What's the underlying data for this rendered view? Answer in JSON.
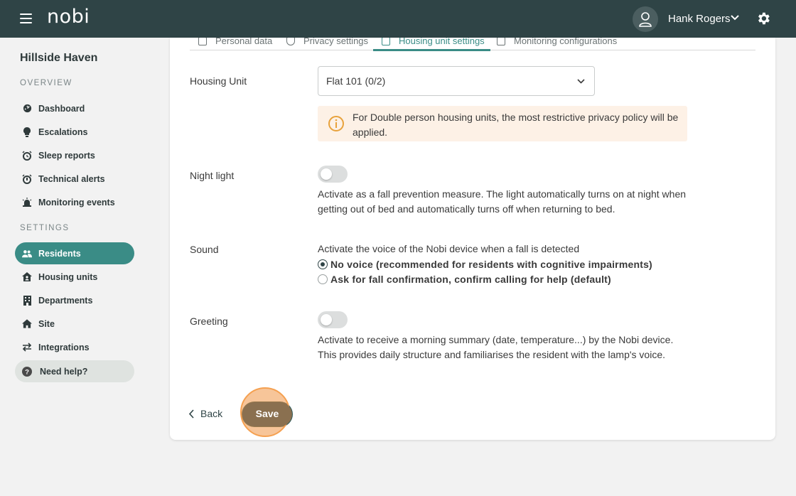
{
  "app": {
    "logo": "nobi"
  },
  "header": {
    "user_name": "Hank Rogers"
  },
  "sidebar": {
    "site_name": "Hillside Haven",
    "overview_label": "OVERVIEW",
    "settings_label": "SETTINGS",
    "overview_items": [
      {
        "label": "Dashboard",
        "icon": "dashboard-icon"
      },
      {
        "label": "Escalations",
        "icon": "bulb-icon"
      },
      {
        "label": "Sleep reports",
        "icon": "alarm-clock-icon"
      },
      {
        "label": "Technical alerts",
        "icon": "alarm-icon"
      },
      {
        "label": "Monitoring events",
        "icon": "siren-icon"
      }
    ],
    "settings_items": [
      {
        "label": "Residents",
        "icon": "people-icon",
        "active": true
      },
      {
        "label": "Housing units",
        "icon": "house-user-icon"
      },
      {
        "label": "Departments",
        "icon": "building-icon"
      },
      {
        "label": "Site",
        "icon": "home-icon"
      },
      {
        "label": "Integrations",
        "icon": "swap-icon"
      }
    ],
    "help_label": "Need help?"
  },
  "tabs": [
    {
      "label": "Personal data"
    },
    {
      "label": "Privacy settings"
    },
    {
      "label": "Housing unit settings",
      "active": true
    },
    {
      "label": "Monitoring configurations"
    }
  ],
  "form": {
    "housing_unit": {
      "label": "Housing Unit",
      "value": "Flat 101 (0/2)",
      "info": "For Double person housing units, the most restrictive privacy policy will be applied."
    },
    "night_light": {
      "label": "Night light",
      "enabled": false,
      "description": "Activate as a fall prevention measure. The light automatically turns on at night when getting out of bed and automatically turns off when returning to bed."
    },
    "sound": {
      "label": "Sound",
      "description": "Activate the voice of the Nobi device when a fall is detected",
      "options": [
        {
          "label": "No voice (recommended for residents with cognitive impairments)",
          "checked": true
        },
        {
          "label": "Ask for fall confirmation, confirm calling for help (default)",
          "checked": false
        }
      ]
    },
    "greeting": {
      "label": "Greeting",
      "enabled": false,
      "description": "Activate to receive a morning summary (date, temperature...) by the Nobi device. This provides daily structure and familiarises the resident with the lamp's voice."
    }
  },
  "actions": {
    "back_label": "Back",
    "save_label": "Save"
  },
  "colors": {
    "topbar": "#2f4446",
    "accent": "#3a8c86",
    "highlight": "#f5a050"
  }
}
